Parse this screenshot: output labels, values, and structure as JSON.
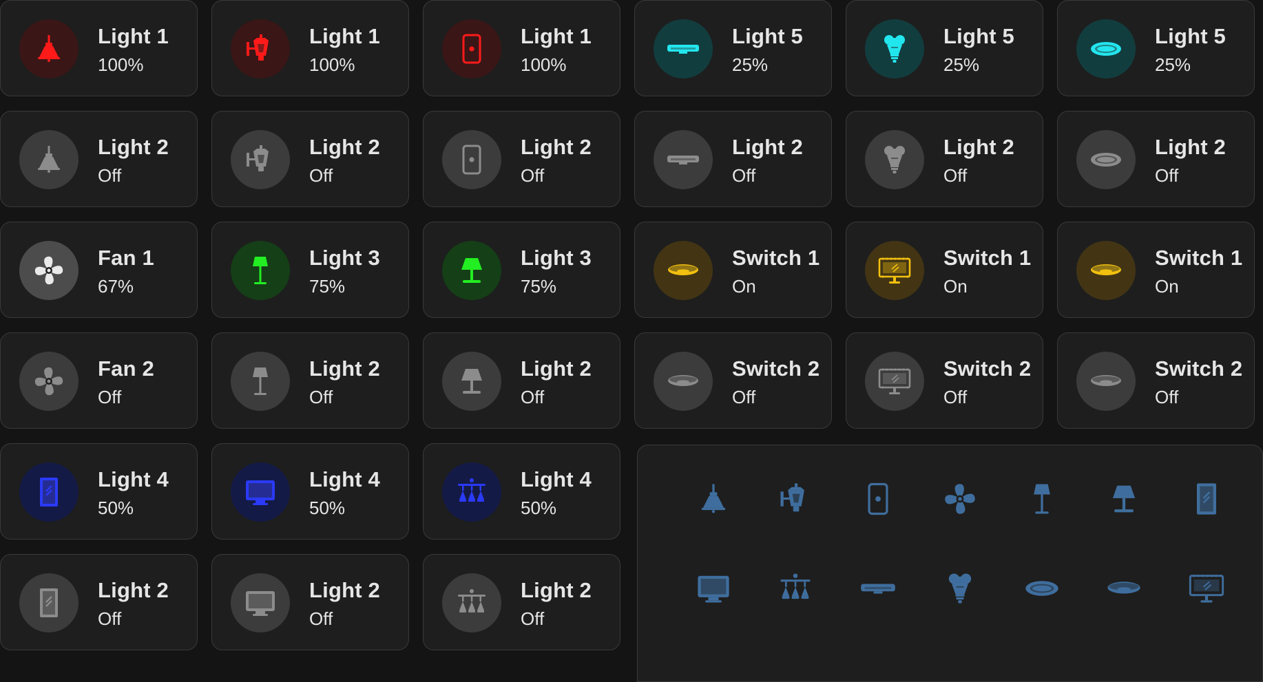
{
  "colors": {
    "red": "#ff1a1a",
    "red_bg": "#3a1616",
    "cyan": "#22e6ee",
    "cyan_bg": "#123d3f",
    "green": "#22ee22",
    "green_bg": "#153f17",
    "yellow": "#f2c00f",
    "yellow_bg": "#433514",
    "blue": "#2a3af6",
    "blue_bg": "#141a46",
    "fan_on": "#e9e9e9",
    "fan_on_bg": "#4c4c4c",
    "off": "#8c8c8c",
    "off_bg": "#3c3c3c",
    "panel_icon": "#3f6e9e"
  },
  "tiles": [
    {
      "name": "Light 1",
      "state": "100%",
      "icon": "ceiling-pendant-icon",
      "tone": "red"
    },
    {
      "name": "Light 1",
      "state": "100%",
      "icon": "outdoor-lamp-icon",
      "tone": "red"
    },
    {
      "name": "Light 1",
      "state": "100%",
      "icon": "wall-switch-icon",
      "tone": "red"
    },
    {
      "name": "Light 5",
      "state": "25%",
      "icon": "light-strip-icon",
      "tone": "cyan"
    },
    {
      "name": "Light 5",
      "state": "25%",
      "icon": "bulb-spot-icon",
      "tone": "cyan"
    },
    {
      "name": "Light 5",
      "state": "25%",
      "icon": "ceiling-ring-icon",
      "tone": "cyan"
    },
    {
      "name": "Light 2",
      "state": "Off",
      "icon": "ceiling-pendant-icon",
      "tone": "off"
    },
    {
      "name": "Light 2",
      "state": "Off",
      "icon": "outdoor-lamp-icon",
      "tone": "off"
    },
    {
      "name": "Light 2",
      "state": "Off",
      "icon": "wall-switch-icon",
      "tone": "off"
    },
    {
      "name": "Light 2",
      "state": "Off",
      "icon": "light-strip-icon",
      "tone": "off"
    },
    {
      "name": "Light 2",
      "state": "Off",
      "icon": "bulb-spot-icon",
      "tone": "off"
    },
    {
      "name": "Light 2",
      "state": "Off",
      "icon": "ceiling-ring-icon",
      "tone": "off"
    },
    {
      "name": "Fan 1",
      "state": "67%",
      "icon": "fan-icon",
      "tone": "fan_on"
    },
    {
      "name": "Light 3",
      "state": "75%",
      "icon": "floor-lamp-icon",
      "tone": "green"
    },
    {
      "name": "Light 3",
      "state": "75%",
      "icon": "table-lamp-icon",
      "tone": "green"
    },
    {
      "name": "Switch 1",
      "state": "On",
      "icon": "ceiling-flush-icon",
      "tone": "yellow"
    },
    {
      "name": "Switch 1",
      "state": "On",
      "icon": "vanity-mirror-icon",
      "tone": "yellow"
    },
    {
      "name": "Switch 1",
      "state": "On",
      "icon": "ceiling-flush-icon",
      "tone": "yellow"
    },
    {
      "name": "Fan 2",
      "state": "Off",
      "icon": "fan-icon",
      "tone": "off"
    },
    {
      "name": "Light 2",
      "state": "Off",
      "icon": "floor-lamp-icon",
      "tone": "off"
    },
    {
      "name": "Light 2",
      "state": "Off",
      "icon": "table-lamp-icon",
      "tone": "off"
    },
    {
      "name": "Switch 2",
      "state": "Off",
      "icon": "ceiling-flush-icon",
      "tone": "off"
    },
    {
      "name": "Switch 2",
      "state": "Off",
      "icon": "vanity-mirror-icon",
      "tone": "off"
    },
    {
      "name": "Switch 2",
      "state": "Off",
      "icon": "ceiling-flush-icon",
      "tone": "off"
    },
    {
      "name": "Light 4",
      "state": "50%",
      "icon": "mirror-icon",
      "tone": "blue"
    },
    {
      "name": "Light 4",
      "state": "50%",
      "icon": "monitor-icon",
      "tone": "blue"
    },
    {
      "name": "Light 4",
      "state": "50%",
      "icon": "chandelier-icon",
      "tone": "blue"
    },
    {
      "name": "Light 2",
      "state": "Off",
      "icon": "mirror-icon",
      "tone": "off"
    },
    {
      "name": "Light 2",
      "state": "Off",
      "icon": "monitor-icon",
      "tone": "off"
    },
    {
      "name": "Light 2",
      "state": "Off",
      "icon": "chandelier-icon",
      "tone": "off"
    }
  ],
  "icon_panel": [
    "ceiling-pendant-icon",
    "outdoor-lamp-icon",
    "wall-switch-icon",
    "fan-icon",
    "floor-lamp-icon",
    "table-lamp-icon",
    "mirror-icon",
    "monitor-icon",
    "chandelier-icon",
    "light-strip-icon",
    "bulb-spot-icon",
    "ceiling-ring-icon",
    "ceiling-flush-icon",
    "vanity-mirror-icon"
  ]
}
